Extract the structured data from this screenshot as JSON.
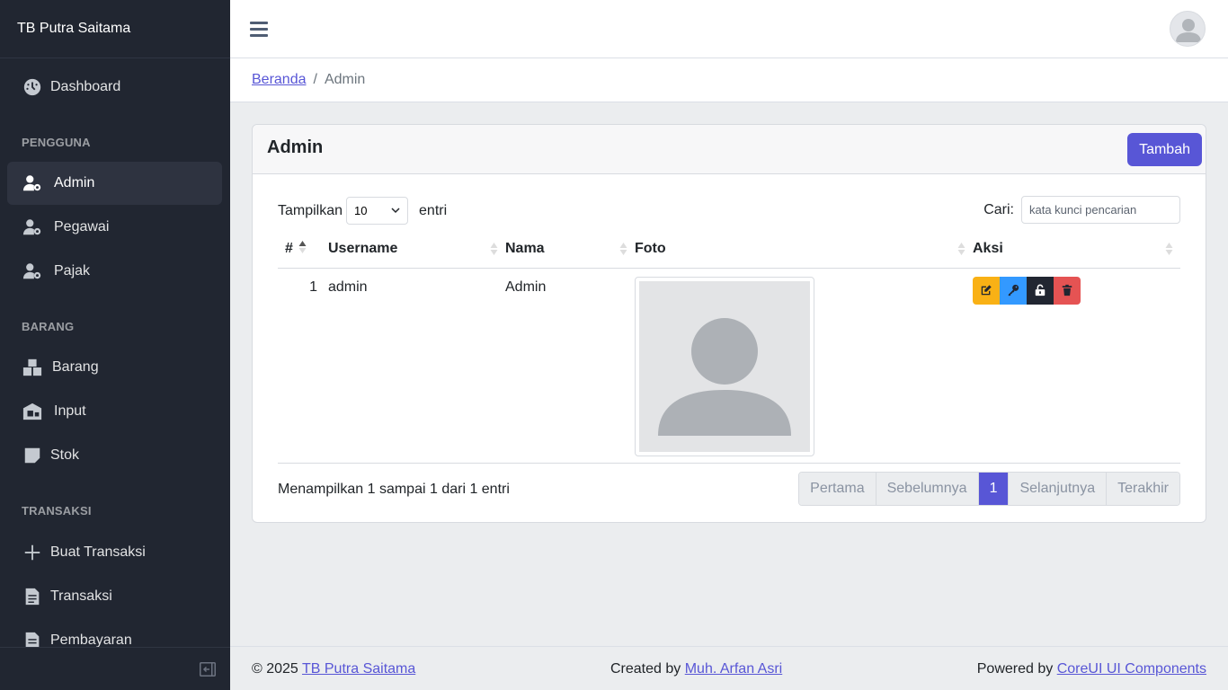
{
  "sidebar": {
    "brand": "TB Putra Saitama",
    "items": [
      {
        "label": "Dashboard",
        "icon": "speedometer-icon"
      },
      {
        "section": "PENGGUNA"
      },
      {
        "label": "Admin",
        "icon": "user-cog-icon",
        "active": true
      },
      {
        "label": "Pegawai",
        "icon": "user-cog-icon"
      },
      {
        "label": "Pajak",
        "icon": "user-cog-icon"
      },
      {
        "section": "BARANG"
      },
      {
        "label": "Barang",
        "icon": "boxes-icon"
      },
      {
        "label": "Input",
        "icon": "warehouse-icon"
      },
      {
        "label": "Stok",
        "icon": "note-icon"
      },
      {
        "section": "TRANSAKSI"
      },
      {
        "label": "Buat Transaksi",
        "icon": "plus-icon"
      },
      {
        "label": "Transaksi",
        "icon": "file-icon"
      },
      {
        "label": "Pembayaran",
        "icon": "file-icon"
      }
    ],
    "dashboard": "Dashboard",
    "section_pengguna": "PENGGUNA",
    "admin": "Admin",
    "pegawai": "Pegawai",
    "pajak": "Pajak",
    "section_barang": "BARANG",
    "barang": "Barang",
    "input": "Input",
    "stok": "Stok",
    "section_transaksi": "TRANSAKSI",
    "buat_transaksi": "Buat Transaksi",
    "transaksi": "Transaksi",
    "pembayaran": "Pembayaran"
  },
  "breadcrumb": {
    "home": "Beranda",
    "current": "Admin"
  },
  "card": {
    "title": "Admin",
    "add_button": "Tambah",
    "show_label": "Tampilkan",
    "show_value": "10",
    "entries_label": "entri",
    "search_label": "Cari:",
    "search_placeholder": "kata kunci pencarian",
    "columns": {
      "no": "#",
      "username": "Username",
      "nama": "Nama",
      "foto": "Foto",
      "aksi": "Aksi"
    },
    "rows": [
      {
        "no": "1",
        "username": "admin",
        "nama": "Admin"
      }
    ],
    "info": "Menampilkan 1 sampai 1 dari 1 entri",
    "pagination": {
      "first": "Pertama",
      "prev": "Sebelumnya",
      "current": "1",
      "next": "Selanjutnya",
      "last": "Terakhir"
    }
  },
  "footer": {
    "copyright_prefix": "© 2025",
    "copyright_link": "TB Putra Saitama",
    "created_prefix": "Created by",
    "created_link": "Muh. Arfan Asri",
    "powered_prefix": "Powered by",
    "powered_link": "CoreUI UI Components"
  },
  "colors": {
    "primary": "#5856d6",
    "sidebar_bg": "#212631",
    "warning": "#f9b115",
    "info": "#3399ff",
    "dark": "#212631",
    "danger": "#e55353"
  }
}
